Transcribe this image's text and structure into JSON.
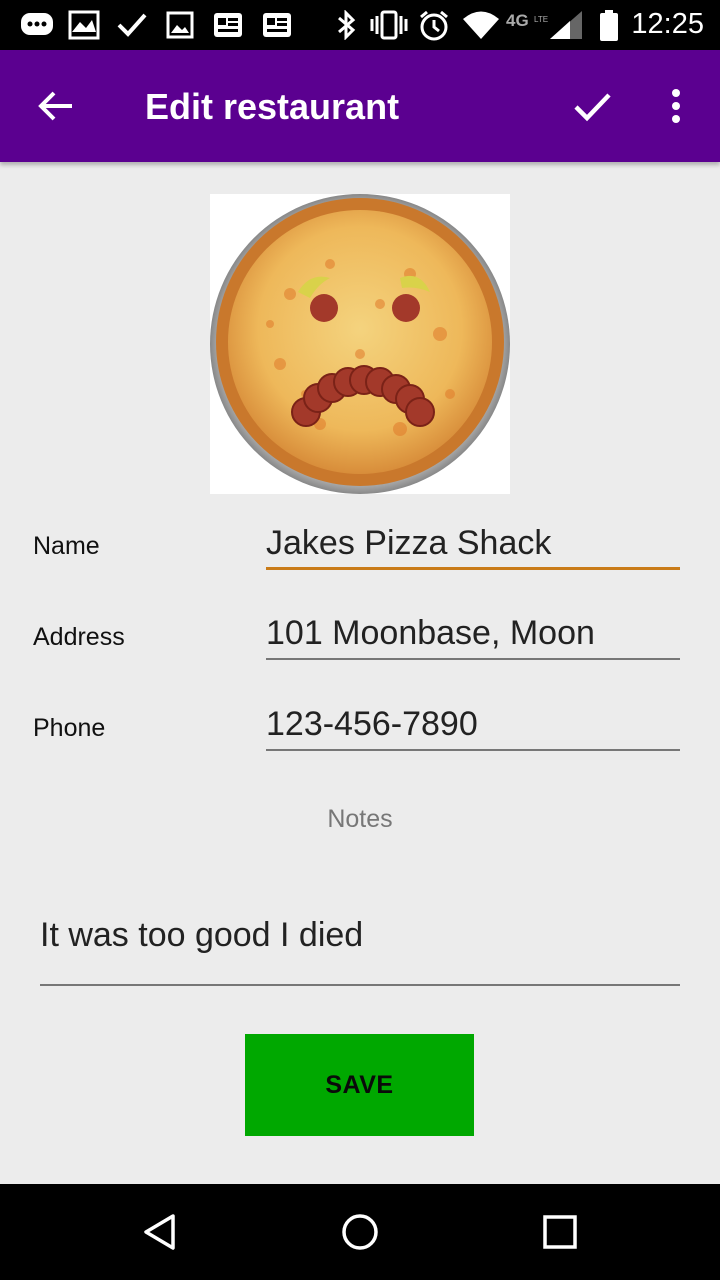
{
  "status_bar": {
    "time": "12:25",
    "icons": [
      "messaging-icon",
      "photos-icon",
      "check-icon",
      "image-icon",
      "news-icon",
      "news-icon",
      "bluetooth-icon",
      "vibrate-icon",
      "alarm-icon",
      "wifi-icon",
      "4g-lte-icon",
      "signal-icon",
      "battery-icon"
    ]
  },
  "app_bar": {
    "title": "Edit restaurant",
    "back_icon": "arrow-back-icon",
    "confirm_icon": "check-icon",
    "more_icon": "more-vert-icon",
    "color": "#5b0090"
  },
  "form": {
    "image_alt": "sad-face-pizza",
    "name": {
      "label": "Name",
      "value": "Jakes Pizza Shack"
    },
    "address": {
      "label": "Address",
      "value": "101 Moonbase, Moon"
    },
    "phone": {
      "label": "Phone",
      "value": "123-456-7890"
    },
    "notes": {
      "label": "Notes",
      "value": "It was too good I died"
    },
    "active_field_color": "#c97b18"
  },
  "save_button": {
    "label": "SAVE",
    "color": "#00a800"
  },
  "nav_bar": {
    "icons": [
      "back-triangle-icon",
      "home-circle-icon",
      "recents-square-icon"
    ]
  }
}
